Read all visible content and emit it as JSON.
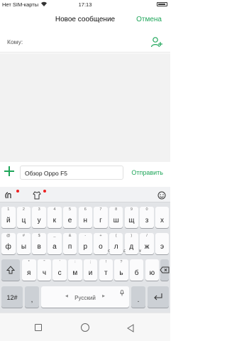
{
  "status_bar": {
    "carrier": "Нет SIM-карты",
    "time": "17:13"
  },
  "header": {
    "title": "Новое сообщение",
    "cancel": "Отмена"
  },
  "recipient": {
    "label": "Кому:"
  },
  "compose": {
    "text": "Обзор Oppo F5",
    "send": "Отправить"
  },
  "keyboard": {
    "row1": [
      {
        "main": "й",
        "hint": "1"
      },
      {
        "main": "ц",
        "hint": "2"
      },
      {
        "main": "у",
        "hint": "3"
      },
      {
        "main": "к",
        "hint": "4"
      },
      {
        "main": "е",
        "hint": "5"
      },
      {
        "main": "н",
        "hint": "6"
      },
      {
        "main": "г",
        "hint": "7"
      },
      {
        "main": "ш",
        "hint": "8"
      },
      {
        "main": "щ",
        "hint": "9"
      },
      {
        "main": "з",
        "hint": "0"
      },
      {
        "main": "х",
        "hint": ""
      }
    ],
    "row2": [
      {
        "main": "ф",
        "hint": "@"
      },
      {
        "main": "ы",
        "hint": "#"
      },
      {
        "main": "в",
        "hint": "$"
      },
      {
        "main": "а",
        "hint": "_"
      },
      {
        "main": "п",
        "hint": "&"
      },
      {
        "main": "р",
        "hint": "-"
      },
      {
        "main": "о",
        "hint": "+"
      },
      {
        "main": "л",
        "hint": "("
      },
      {
        "main": "д",
        "hint": ")"
      },
      {
        "main": "ж",
        "hint": "/"
      },
      {
        "main": "э",
        "hint": ""
      }
    ],
    "row2_secondary": [
      "€",
      "£",
      "¥"
    ],
    "row3": [
      {
        "main": "я",
        "hint": "*"
      },
      {
        "main": "ч",
        "hint": "\""
      },
      {
        "main": "с",
        "hint": "'"
      },
      {
        "main": "м",
        "hint": ":"
      },
      {
        "main": "и",
        "hint": ";"
      },
      {
        "main": "т",
        "hint": "!"
      },
      {
        "main": "ь",
        "hint": "?"
      },
      {
        "main": "б",
        "hint": ""
      },
      {
        "main": "ю",
        "hint": ""
      }
    ],
    "row4": {
      "numbers": "12#",
      "comma": ",",
      "space": "Русский",
      "period": "."
    }
  }
}
